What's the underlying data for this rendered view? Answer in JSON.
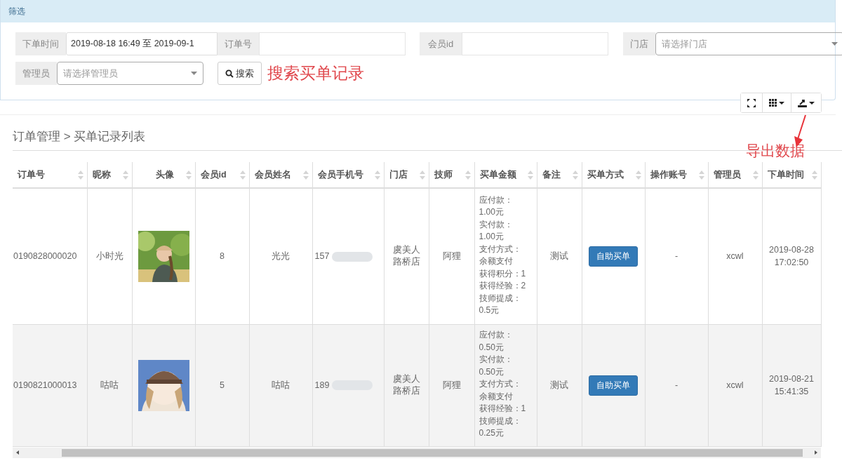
{
  "panel_title": "筛选",
  "filters": [
    {
      "kind": "text",
      "label": "下单时间",
      "value": "2019-08-18 16:49 至 2019-09-1"
    },
    {
      "kind": "text",
      "label": "订单号"
    },
    {
      "kind": "text",
      "label": "会员id"
    },
    {
      "kind": "select",
      "label": "门店",
      "placeholder": "请选择门店"
    },
    {
      "kind": "select",
      "label": "管理员",
      "placeholder": "请选择管理员"
    }
  ],
  "search_button": "搜索",
  "annotations": [
    {
      "kind": "search",
      "text": "搜索买单记录"
    },
    {
      "kind": "export",
      "text": "导出数据"
    }
  ],
  "breadcrumb": "订单管理 > 买单记录列表",
  "table": {
    "columns": [
      "订单号",
      "昵称",
      "头像",
      "会员id",
      "会员姓名",
      "会员手机号",
      "门店",
      "技师",
      "买单金额",
      "备注",
      "买单方式",
      "操作账号",
      "管理员",
      "下单时间"
    ],
    "rows": [
      {
        "order_no": "0190828000020",
        "nickname": "小时光",
        "avatar": {
          "kind": "picture"
        },
        "member_id": "8",
        "member_name": "光光",
        "phone": "157",
        "store": "虞美人路桥店",
        "technician": "阿狸",
        "amount": [
          "应付款：",
          "1.00元",
          "实付款：",
          "1.00元",
          "支付方式：",
          "余额支付",
          "获得积分：1",
          "获得经验：2",
          "技师提成：",
          "0.5元"
        ],
        "remark": "测试",
        "method": "自助买单",
        "operator": "-",
        "admin": "xcwl",
        "time": "2019-08-28 17:02:50"
      },
      {
        "order_no": "0190821000013",
        "nickname": "咕咕",
        "avatar": {
          "kind": "picture"
        },
        "member_id": "5",
        "member_name": "咕咕",
        "phone": "189",
        "store": "虞美人路桥店",
        "technician": "阿狸",
        "amount": [
          "应付款：",
          "0.50元",
          "实付款：",
          "0.50元",
          "支付方式：",
          "余额支付",
          "获得经验：1",
          "技师提成：",
          "0.25元"
        ],
        "remark": "测试",
        "method": "自助买单",
        "operator": "-",
        "admin": "xcwl",
        "time": "2019-08-21 15:41:35"
      }
    ]
  }
}
